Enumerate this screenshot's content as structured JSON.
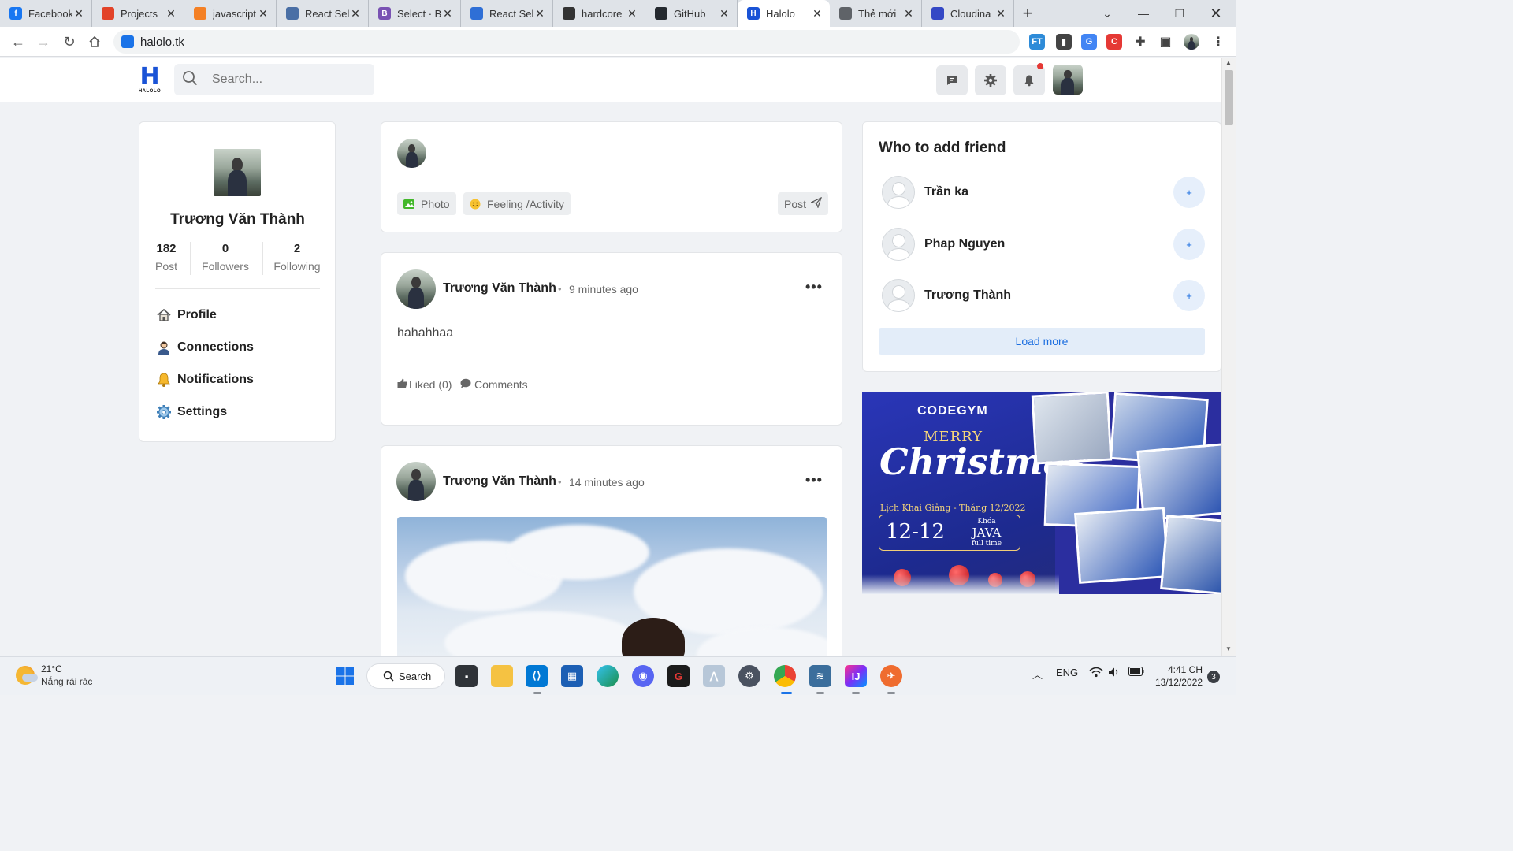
{
  "browser": {
    "tabs": [
      {
        "title": "Facebook",
        "fav": "f",
        "color": "#1877f2"
      },
      {
        "title": "Projects",
        "fav": "",
        "color": "#e24329"
      },
      {
        "title": "javascript",
        "fav": "",
        "color": "#f48024"
      },
      {
        "title": "React Sel",
        "fav": "",
        "color": "#4a6fa5"
      },
      {
        "title": "Select · B",
        "fav": "B",
        "color": "#7952b3"
      },
      {
        "title": "React Sel",
        "fav": "",
        "color": "#2f6fd6"
      },
      {
        "title": "hardcore",
        "fav": "",
        "color": "#333333"
      },
      {
        "title": "GitHub",
        "fav": "",
        "color": "#24292f"
      },
      {
        "title": "Halolo",
        "fav": "H",
        "color": "#1a53d6"
      },
      {
        "title": "Thẻ mới",
        "fav": "",
        "color": "#5f6368"
      },
      {
        "title": "Cloudina",
        "fav": "",
        "color": "#3448c5"
      }
    ],
    "active_tab_index": 8,
    "url": "halolo.tk"
  },
  "header": {
    "logo_letter": "H",
    "logo_text": "HALOLO",
    "search_placeholder": "Search..."
  },
  "profile": {
    "name": "Trương Văn Thành",
    "stats": [
      {
        "value": "182",
        "label": "Post"
      },
      {
        "value": "0",
        "label": "Followers"
      },
      {
        "value": "2",
        "label": "Following"
      }
    ],
    "menu": [
      {
        "label": "Profile",
        "icon": "home-icon"
      },
      {
        "label": "Connections",
        "icon": "user-icon"
      },
      {
        "label": "Notifications",
        "icon": "bell-icon"
      },
      {
        "label": "Settings",
        "icon": "gear-icon"
      }
    ]
  },
  "composer": {
    "photo_label": "Photo",
    "feeling_label": "Feeling /Activity",
    "post_label": "Post"
  },
  "posts": [
    {
      "author": "Trương Văn Thành",
      "time": "9 minutes ago",
      "text": "hahahhaa",
      "liked_label": "Liked (0)",
      "comments_label": "Comments"
    },
    {
      "author": "Trương Văn Thành",
      "time": "14 minutes ago"
    }
  ],
  "suggestions": {
    "title": "Who to add friend",
    "people": [
      {
        "name": "Trần ka"
      },
      {
        "name": "Phap Nguyen"
      },
      {
        "name": "Trương Thành"
      }
    ],
    "add_symbol": "+",
    "load_more": "Load more"
  },
  "banner": {
    "brand": "CODEGYM",
    "merry": "MERRY",
    "christmas": "Christmas",
    "schedule": "Lịch Khai Giảng - Tháng 12/2022",
    "date": "12-12",
    "course_prefix": "Khóa",
    "course": "JAVA",
    "course_suffix": "full time"
  },
  "taskbar": {
    "temperature": "21°C",
    "weather": "Nắng rải rác",
    "search_label": "Search",
    "language": "ENG",
    "time": "4:41 CH",
    "date": "13/12/2022",
    "notification_count": "3"
  }
}
